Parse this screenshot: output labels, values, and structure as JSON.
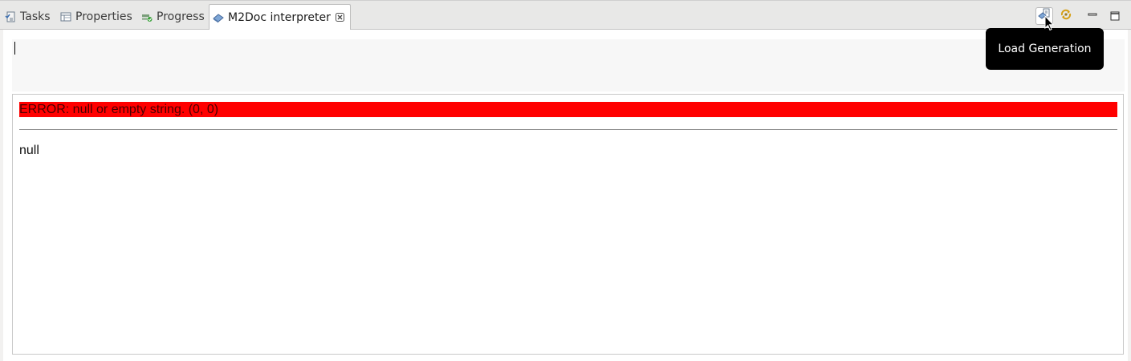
{
  "tabs": [
    {
      "label": "Tasks",
      "icon": "tasks-icon"
    },
    {
      "label": "Properties",
      "icon": "properties-icon"
    },
    {
      "label": "Progress",
      "icon": "progress-icon"
    },
    {
      "label": "M2Doc interpreter",
      "icon": "m2doc-icon",
      "active": true
    }
  ],
  "toolbar": {
    "load_generation_icon": "load-generation-icon",
    "refresh_icon": "refresh-icon",
    "minimize_icon": "minimize-icon",
    "maximize_icon": "maximize-icon",
    "tooltip": "Load Generation"
  },
  "expression": {
    "value": ""
  },
  "result": {
    "error": "ERROR: null or empty string. (0, 0)",
    "value": "null"
  },
  "colors": {
    "error_bg": "#ff0000",
    "tooltip_bg": "#000000",
    "expr_bg": "#f7f7f7"
  }
}
